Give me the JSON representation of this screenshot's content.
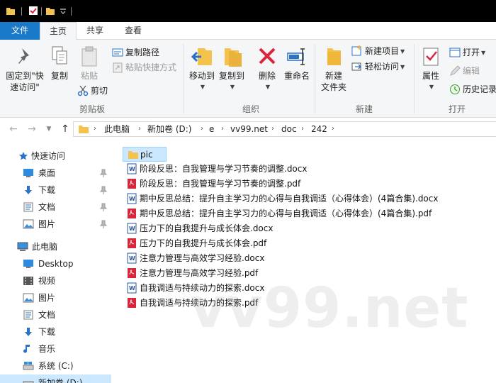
{
  "ribbon_tabs": {
    "file": "文件",
    "home": "主页",
    "share": "共享",
    "view": "查看"
  },
  "clipboard": {
    "pin_line1": "固定到\"快",
    "pin_line2": "速访问\"",
    "copy": "复制",
    "paste": "粘贴",
    "copy_path": "复制路径",
    "paste_shortcut": "粘贴快捷方式",
    "cut": "剪切",
    "group_label": "剪贴板"
  },
  "organize": {
    "move_to": "移动到",
    "copy_to": "复制到",
    "delete": "删除",
    "rename": "重命名",
    "group_label": "组织"
  },
  "new_group": {
    "new_folder_line1": "新建",
    "new_folder_line2": "文件夹",
    "new_item": "新建项目",
    "easy_access": "轻松访问",
    "group_label": "新建"
  },
  "open_group": {
    "properties": "属性",
    "open": "打开",
    "edit": "编辑",
    "history": "历史记录",
    "group_label": "打开"
  },
  "breadcrumb": [
    "此电脑",
    "新加卷 (D:)",
    "e",
    "vv99.net",
    "doc",
    "242"
  ],
  "sidebar": {
    "quick_access": "快速访问",
    "qa_items": [
      "桌面",
      "下载",
      "文档",
      "图片"
    ],
    "this_pc": "此电脑",
    "pc_items": [
      "Desktop",
      "视频",
      "图片",
      "文档",
      "下载",
      "音乐",
      "系统 (C:)",
      "新加卷 (D:)"
    ]
  },
  "files": [
    {
      "name": "pic",
      "type": "folder"
    },
    {
      "name": "阶段反思：自我管理与学习节奏的调整.docx",
      "type": "docx"
    },
    {
      "name": "阶段反思：自我管理与学习节奏的调整.pdf",
      "type": "pdf"
    },
    {
      "name": "期中反思总结：提升自主学习力的心得与自我调适（心得体会）(4篇合集).docx",
      "type": "docx"
    },
    {
      "name": "期中反思总结：提升自主学习力的心得与自我调适（心得体会）(4篇合集).pdf",
      "type": "pdf"
    },
    {
      "name": "压力下的自我提升与成长体会.docx",
      "type": "docx"
    },
    {
      "name": "压力下的自我提升与成长体会.pdf",
      "type": "pdf"
    },
    {
      "name": "注意力管理与高效学习经验.docx",
      "type": "docx"
    },
    {
      "name": "注意力管理与高效学习经验.pdf",
      "type": "pdf"
    },
    {
      "name": "自我调适与持续动力的探索.docx",
      "type": "docx"
    },
    {
      "name": "自我调适与持续动力的探索.pdf",
      "type": "pdf"
    }
  ],
  "watermark": "vv99.net",
  "colors": {
    "accent": "#1979ca",
    "selection": "#cce8ff",
    "folder": "#f4c34d",
    "pdf": "#d9263b",
    "docx": "#2a5699"
  }
}
